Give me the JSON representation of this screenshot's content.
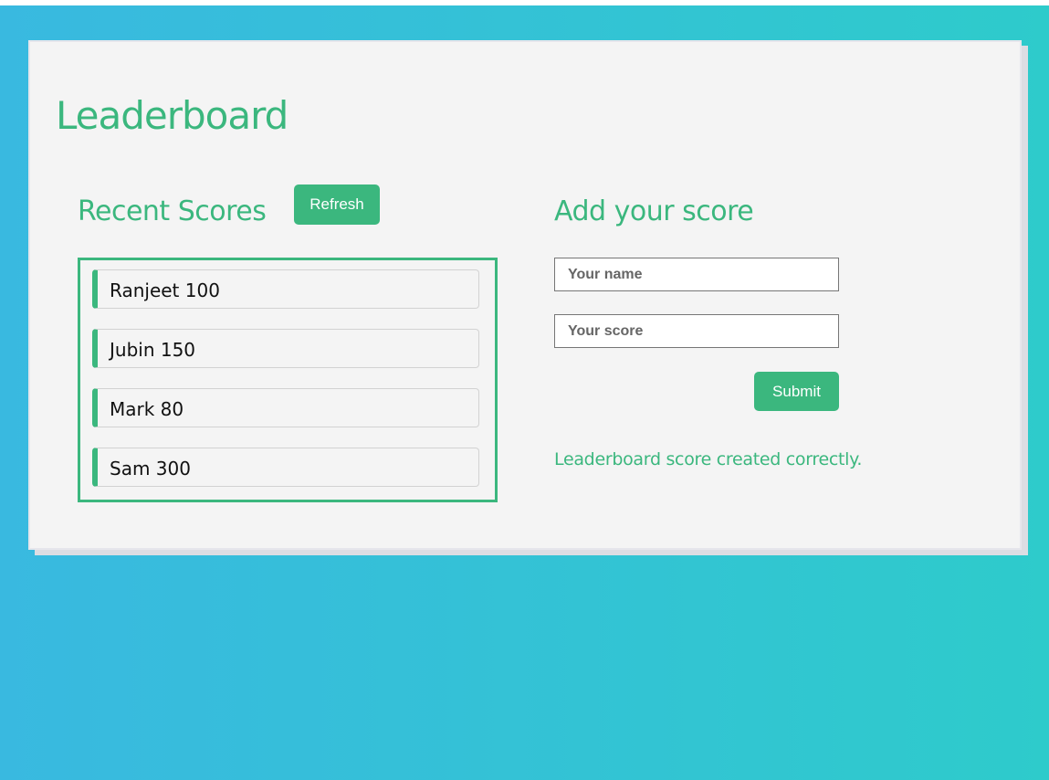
{
  "page": {
    "title": "Leaderboard"
  },
  "recent_scores": {
    "heading": "Recent Scores",
    "refresh_label": "Refresh",
    "items": [
      {
        "name": "Ranjeet",
        "score": 100,
        "label": "Ranjeet 100"
      },
      {
        "name": "Jubin",
        "score": 150,
        "label": "Jubin 150"
      },
      {
        "name": "Mark",
        "score": 80,
        "label": "Mark 80"
      },
      {
        "name": "Sam",
        "score": 300,
        "label": "Sam 300"
      }
    ]
  },
  "add_score": {
    "heading": "Add your score",
    "name_field": {
      "value": "",
      "placeholder": "Your name"
    },
    "score_field": {
      "value": "",
      "placeholder": "Your score"
    },
    "submit_label": "Submit",
    "status_message": "Leaderboard score created correctly."
  },
  "colors": {
    "accent": "#3bb77e",
    "background_start": "#39b9e0",
    "background_end": "#2ecbcb",
    "card": "#f4f4f4"
  }
}
